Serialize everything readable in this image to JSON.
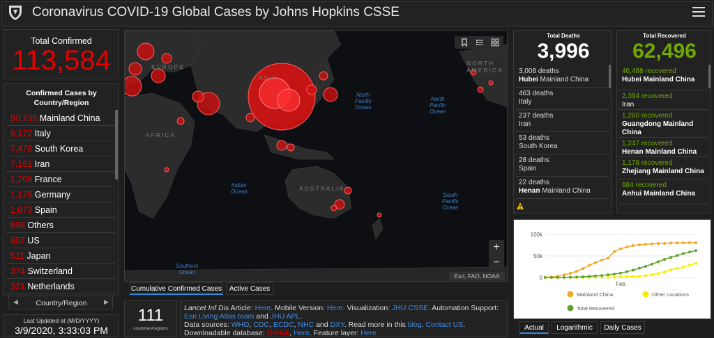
{
  "header": {
    "title": "Coronavirus COVID-19 Global Cases by Johns Hopkins CSSE",
    "logo_icon": "jhu-shield-icon",
    "menu_icon": "hamburger-menu-icon"
  },
  "total_confirmed": {
    "label": "Total Confirmed",
    "value": "113,584",
    "color": "#e60000"
  },
  "confirmed_by_country": {
    "title": "Confirmed Cases by Country/Region",
    "rows": [
      {
        "count": "80,735",
        "name": "Mainland China"
      },
      {
        "count": "9,172",
        "name": "Italy"
      },
      {
        "count": "7,478",
        "name": "South Korea"
      },
      {
        "count": "7,161",
        "name": "Iran"
      },
      {
        "count": "1,209",
        "name": "France"
      },
      {
        "count": "1,176",
        "name": "Germany"
      },
      {
        "count": "1,073",
        "name": "Spain"
      },
      {
        "count": "696",
        "name": "Others"
      },
      {
        "count": "607",
        "name": "US"
      },
      {
        "count": "511",
        "name": "Japan"
      },
      {
        "count": "374",
        "name": "Switzerland"
      },
      {
        "count": "321",
        "name": "Netherlands"
      }
    ],
    "nav_label": "Country/Region"
  },
  "last_updated": {
    "label": "Last Updated at (M/D/YYYY)",
    "value": "3/9/2020, 3:33:03 PM"
  },
  "map": {
    "regions": [
      "EUROPE",
      "ASIA",
      "AFRICA",
      "AUSTRALIA",
      "NORTH AMERICA"
    ],
    "oceans": {
      "north_pacific_1": [
        "North",
        "Pacific",
        "Ocean"
      ],
      "north_pacific_2": [
        "North",
        "Pacific",
        "Ocean"
      ],
      "indian": [
        "Indian",
        "Ocean"
      ],
      "south_pacific": [
        "South",
        "Pacific",
        "Ocean"
      ],
      "southern": [
        "Southern",
        "Ocean"
      ]
    },
    "attribution": "Esri, FAO, NOAA",
    "zoom_in": "+",
    "zoom_out": "−",
    "tabs": [
      "Cumulative Confirmed Cases",
      "Active Cases"
    ]
  },
  "countries_count": {
    "value": "111",
    "label": "countries/regions"
  },
  "info": {
    "line1_pre": "Lancet Inf Dis",
    "line1_a": " Article: ",
    "here1": "Here",
    "mobile": ". Mobile Version: ",
    "here2": "Here",
    "viz": ". Visualization: ",
    "jhu_csse": "JHU CSSE",
    "auto": ". Automation Support:",
    "esri_team": "Esri Living Atlas team",
    "and": " and ",
    "jhu_apl": "JHU APL",
    "period": ".",
    "data_sources": "Data sources: ",
    "who": "WHO",
    "cdc": "CDC",
    "ecdc": "ECDC",
    "nhc": "NHC",
    "dxy": "DXY",
    "read_more": ". Read more in this ",
    "blog": "blog",
    "contact": "Contact US",
    "download": "Downloadable database: ",
    "github": "GitHub",
    "comma": ", ",
    "here3": "Here",
    "feature": ". Feature layer: ",
    "here4": "Here"
  },
  "total_deaths": {
    "label": "Total Deaths",
    "value": "3,996",
    "rows": [
      {
        "count": "3,008 deaths",
        "bold": "Hubei",
        "place": " Mainland China"
      },
      {
        "count": "463 deaths",
        "bold": "",
        "place": "Italy"
      },
      {
        "count": "237 deaths",
        "bold": "",
        "place": "Iran"
      },
      {
        "count": "53 deaths",
        "bold": "",
        "place": "South Korea"
      },
      {
        "count": "28 deaths",
        "bold": "",
        "place": "Spain"
      },
      {
        "count": "22 deaths",
        "bold": "Henan",
        "place": " Mainland China"
      }
    ]
  },
  "total_recovered": {
    "label": "Total Recovered",
    "value": "62,496",
    "color": "#70a800",
    "rows": [
      {
        "count": "46,488 recovered",
        "bold": "Hubei Mainland China",
        "plain": ""
      },
      {
        "count": "2,394 recovered",
        "bold": "",
        "plain": "Iran"
      },
      {
        "count": "1,260 recovered",
        "bold": "Guangdong Mainland China",
        "plain": ""
      },
      {
        "count": "1,247 recovered",
        "bold": "Henan Mainland China",
        "plain": ""
      },
      {
        "count": "1,176 recovered",
        "bold": "Zhejiang Mainland China",
        "plain": ""
      },
      {
        "count": "984 recovered",
        "bold": "Anhui Mainland China",
        "plain": ""
      }
    ]
  },
  "chart_data": {
    "type": "line",
    "y_ticks": [
      "100k",
      "50k",
      "0"
    ],
    "ylim": [
      0,
      100000
    ],
    "x_tick": "Feb",
    "series": [
      {
        "name": "Mainland China",
        "color": "#f5a623",
        "values": [
          600,
          1300,
          2800,
          6000,
          9800,
          14400,
          20600,
          28000,
          34500,
          40200,
          44700,
          60000,
          66600,
          70500,
          74200,
          75600,
          77200,
          78100,
          78800,
          79300,
          79900,
          80300,
          80500,
          80700,
          80700
        ]
      },
      {
        "name": "Other Locations",
        "color": "#f2f200",
        "values": [
          0,
          20,
          50,
          80,
          120,
          180,
          250,
          300,
          400,
          450,
          600,
          800,
          1200,
          1800,
          2400,
          3300,
          4500,
          6500,
          9000,
          12700,
          17500,
          21000,
          24000,
          28500,
          32800
        ]
      },
      {
        "name": "Total Recovered",
        "color": "#5fa22b",
        "values": [
          30,
          60,
          150,
          300,
          600,
          1000,
          1700,
          2600,
          3600,
          4700,
          6200,
          8000,
          10000,
          13500,
          17000,
          21500,
          26000,
          31000,
          36500,
          42000,
          46500,
          51000,
          55500,
          59000,
          62496
        ]
      }
    ],
    "tabs": [
      "Actual",
      "Logarithmic",
      "Daily Cases"
    ]
  }
}
